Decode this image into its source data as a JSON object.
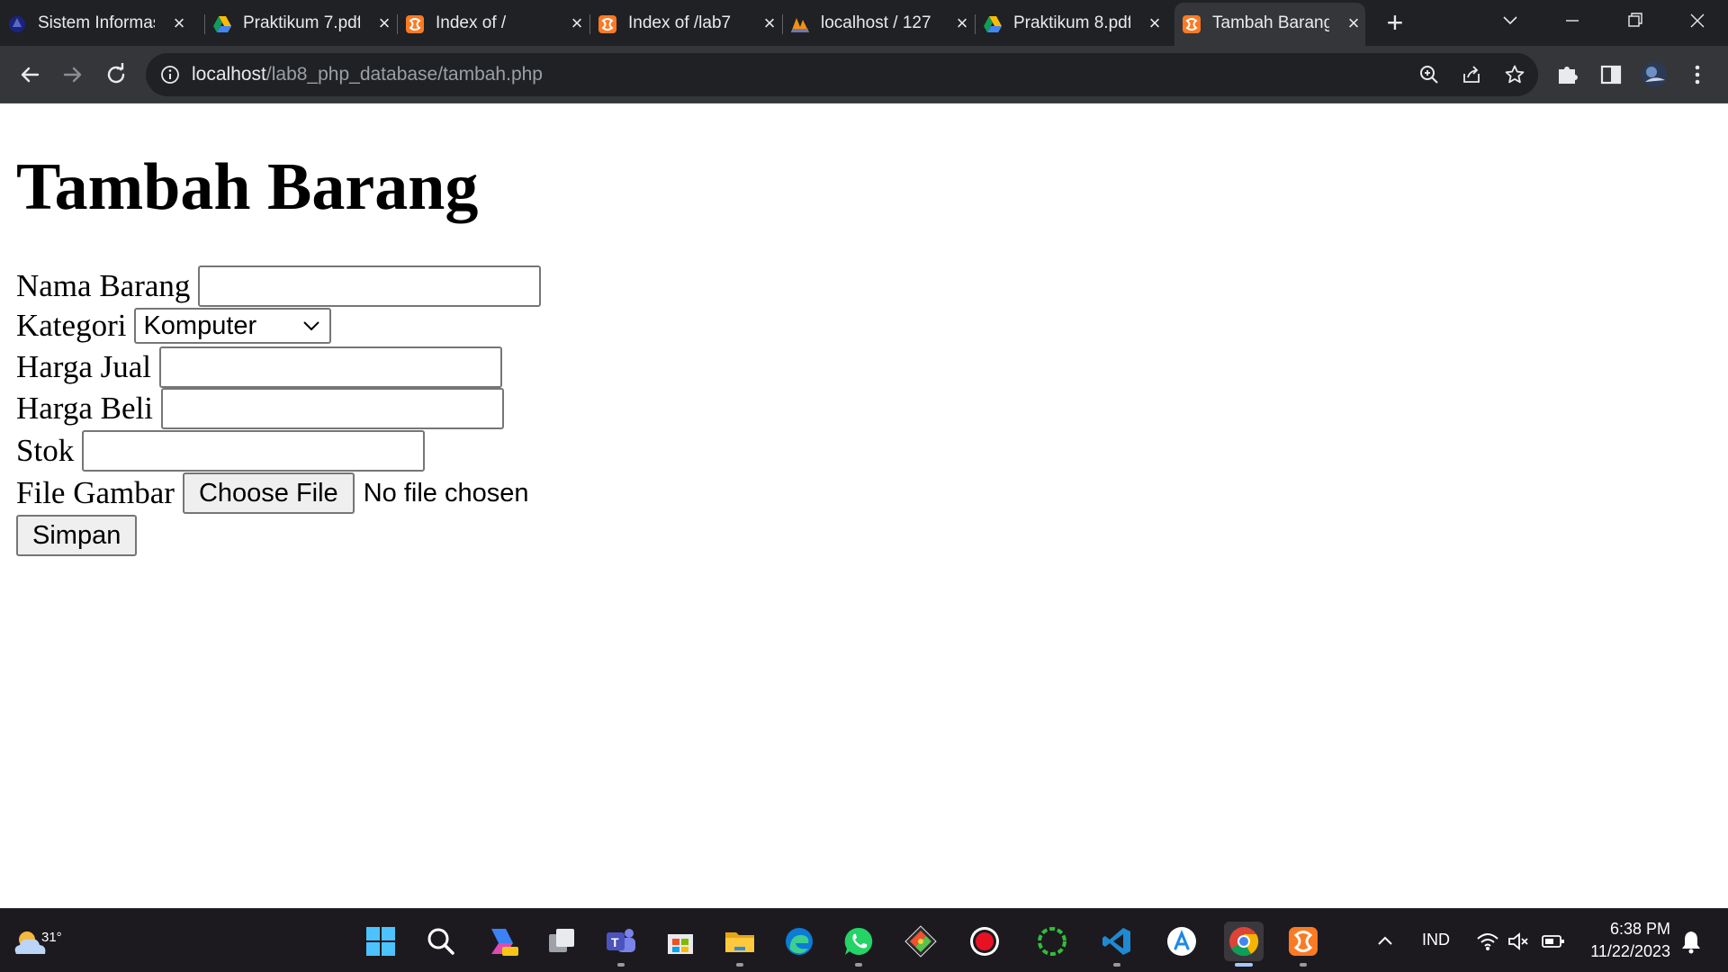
{
  "browser": {
    "tabs": [
      {
        "title": "Sistem Informasi",
        "favicon": "app-icon",
        "active": false
      },
      {
        "title": "Praktikum 7.pdf",
        "favicon": "google-drive-icon",
        "active": false
      },
      {
        "title": "Index of /",
        "favicon": "xampp-icon",
        "active": false
      },
      {
        "title": "Index of /lab7",
        "favicon": "xampp-icon",
        "active": false
      },
      {
        "title": "localhost / 127",
        "favicon": "phpmyadmin-icon",
        "active": false
      },
      {
        "title": "Praktikum 8.pdf",
        "favicon": "google-drive-icon",
        "active": false
      },
      {
        "title": "Tambah Barang",
        "favicon": "xampp-icon",
        "active": true
      }
    ],
    "url_host": "localhost",
    "url_path": "/lab8_php_database/tambah.php"
  },
  "page": {
    "title": "Tambah Barang",
    "fields": {
      "nama_label": "Nama Barang",
      "kategori_label": "Kategori",
      "kategori_selected": "Komputer",
      "harga_jual_label": "Harga Jual",
      "harga_beli_label": "Harga Beli",
      "stok_label": "Stok",
      "file_label": "File Gambar",
      "file_button": "Choose File",
      "file_status": "No file chosen"
    },
    "submit_label": "Simpan"
  },
  "taskbar": {
    "weather_temp": "31°",
    "language": "IND",
    "time": "6:38 PM",
    "date": "11/22/2023",
    "apps": [
      "windows-start-icon",
      "search-icon",
      "copilot-icon",
      "task-view-icon",
      "teams-icon",
      "microsoft-store-icon",
      "file-explorer-icon",
      "edge-icon",
      "whatsapp-icon",
      "git-icon",
      "obs-record-icon",
      "spinner-app-icon",
      "vscode-icon",
      "app-store-icon",
      "chrome-icon",
      "xampp-icon"
    ]
  },
  "colors": {
    "tab_strip": "#202124",
    "toolbar": "#35363a",
    "taskbar": "#1c1a1f"
  }
}
